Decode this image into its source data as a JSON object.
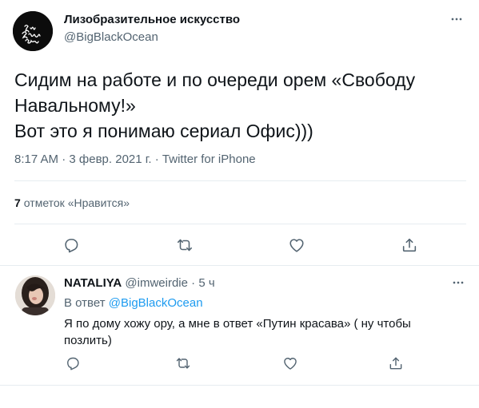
{
  "tweet": {
    "author": {
      "display_name": "Лизобразительное искусство",
      "handle": "@BigBlackOcean"
    },
    "text": "Сидим на работе и по очереди орем «Свободу Навальному!»\nВот это я понимаю сериал Офис)))",
    "time": "8:17 AM",
    "date": "3 февр. 2021 г.",
    "source": "Twitter for iPhone",
    "separator": "·",
    "likes": {
      "count": "7",
      "label": "отметок «Нравится»"
    },
    "actions": [
      "reply-icon",
      "retweet-icon",
      "like-icon",
      "share-icon"
    ],
    "more_icon": "more-icon"
  },
  "reply": {
    "author": {
      "display_name": "NATALIYA",
      "handle": "@imweirdie"
    },
    "separator": "·",
    "time": "5 ч",
    "replying_to_label": "В ответ",
    "replying_to_handle": "@BigBlackOcean",
    "text": "Я по дому хожу ору, а мне в ответ «Путин красава» ( ну чтобы позлить)",
    "actions": [
      "reply-icon",
      "retweet-icon",
      "like-icon",
      "share-icon"
    ],
    "more_icon": "more-icon"
  },
  "colors": {
    "text_primary": "#0f1419",
    "text_secondary": "#536471",
    "accent": "#1d9bf0",
    "divider": "#e6ecf0"
  }
}
